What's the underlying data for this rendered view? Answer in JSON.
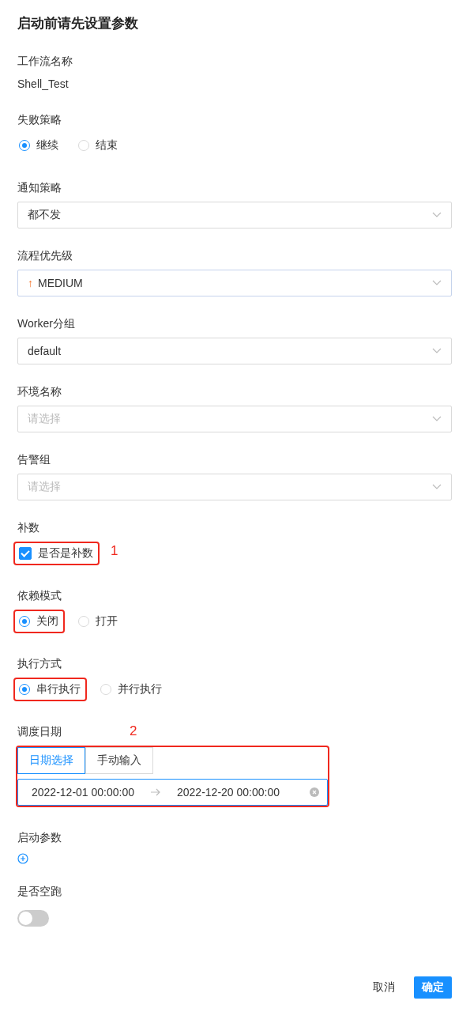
{
  "title": "启动前请先设置参数",
  "fields": [
    {
      "kind": "text",
      "label": "工作流名称",
      "value": "Shell_Test"
    },
    {
      "kind": "radio",
      "label": "失败策略",
      "options": [
        {
          "label": "继续",
          "selected": true,
          "highlighted": false
        },
        {
          "label": "结束",
          "selected": false,
          "highlighted": false
        }
      ]
    },
    {
      "kind": "select",
      "label": "通知策略",
      "value": "都不发"
    },
    {
      "kind": "select",
      "label": "流程优先级",
      "prefix": "↑",
      "value": "MEDIUM"
    },
    {
      "kind": "select",
      "label": "Worker分组",
      "value": "default"
    },
    {
      "kind": "select",
      "label": "环境名称",
      "placeholder": "请选择"
    },
    {
      "kind": "select",
      "label": "告警组",
      "placeholder": "请选择"
    },
    {
      "kind": "checkbox",
      "label": "补数",
      "annotation": "1",
      "options": [
        {
          "label": "是否是补数",
          "checked": true,
          "highlighted": true
        }
      ]
    },
    {
      "kind": "radio",
      "label": "依赖模式",
      "options": [
        {
          "label": "关闭",
          "selected": true,
          "highlighted": true
        },
        {
          "label": "打开",
          "selected": false,
          "highlighted": false
        }
      ]
    },
    {
      "kind": "radio",
      "label": "执行方式",
      "options": [
        {
          "label": "串行执行",
          "selected": true,
          "highlighted": true
        },
        {
          "label": "并行执行",
          "selected": false,
          "highlighted": false
        }
      ]
    },
    {
      "kind": "daterange",
      "label": "调度日期",
      "annotation": "2",
      "highlighted": true,
      "tabs": [
        {
          "label": "日期选择",
          "selected": true
        },
        {
          "label": "手动输入",
          "selected": false
        }
      ],
      "start": "2022-12-01 00:00:00",
      "end": "2022-12-20 00:00:00"
    },
    {
      "kind": "add",
      "label": "启动参数"
    },
    {
      "kind": "switch",
      "label": "是否空跑",
      "on": false
    }
  ],
  "buttons": [
    {
      "label": "取消",
      "primary": false
    },
    {
      "label": "确定",
      "primary": true
    }
  ]
}
